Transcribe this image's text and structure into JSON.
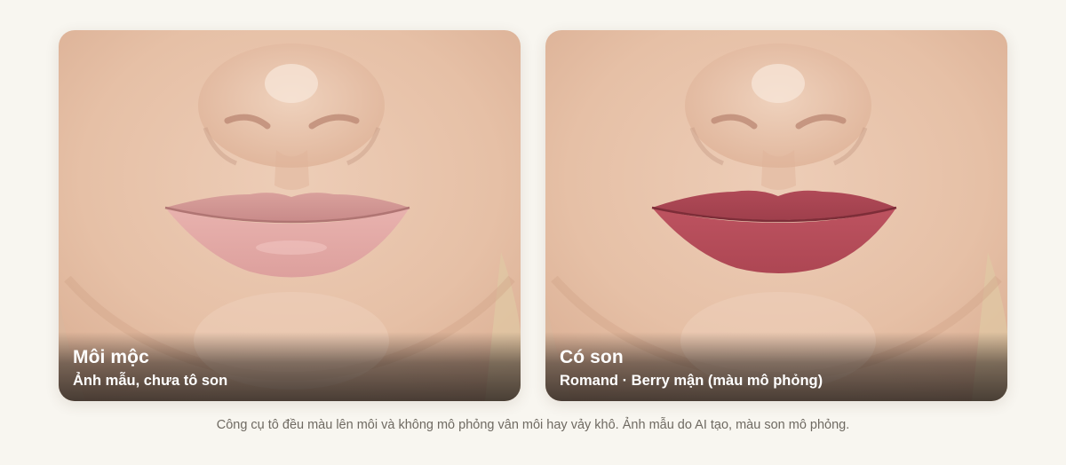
{
  "comparison": {
    "before": {
      "title": "Môi mộc",
      "subtitle": "Ảnh mẫu, chưa tô son",
      "lip_color": "#e3a7a4"
    },
    "after": {
      "title": "Có son",
      "subtitle": "Romand · Berry mận (màu mô phỏng)",
      "lip_color": "#b44a58"
    }
  },
  "footnote": "Công cụ tô đều màu lên môi và không mô phỏng vân môi hay vảy khô. Ảnh mẫu do AI tạo, màu son mô phỏng.",
  "colors": {
    "page_background": "#f8f6f0",
    "skin": "#e9c5ad",
    "caption_text": "#ffffff",
    "footnote_text": "#6f6a62"
  }
}
